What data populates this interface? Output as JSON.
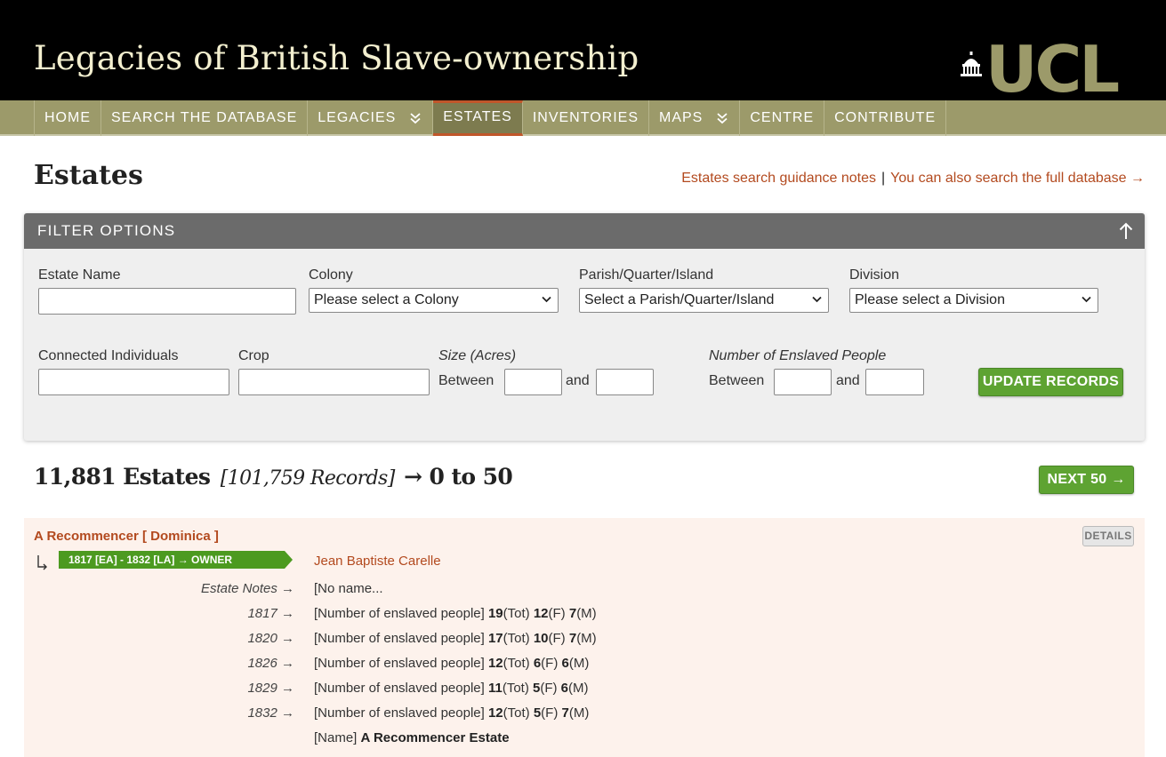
{
  "header": {
    "site_title": "Legacies of British Slave-ownership",
    "logo_text": "UCL"
  },
  "nav": {
    "items": [
      {
        "label": "HOME",
        "dropdown": false,
        "active": false
      },
      {
        "label": "SEARCH THE DATABASE",
        "dropdown": false,
        "active": false
      },
      {
        "label": "LEGACIES",
        "dropdown": true,
        "active": false
      },
      {
        "label": "ESTATES",
        "dropdown": false,
        "active": true
      },
      {
        "label": "INVENTORIES",
        "dropdown": false,
        "active": false
      },
      {
        "label": "MAPS",
        "dropdown": true,
        "active": false
      },
      {
        "label": "CENTRE",
        "dropdown": false,
        "active": false
      },
      {
        "label": "CONTRIBUTE",
        "dropdown": false,
        "active": false
      }
    ]
  },
  "page": {
    "title": "Estates",
    "guidance_link": "Estates search guidance notes",
    "separator": "|",
    "full_db_link": "You can also search the full database →"
  },
  "filter": {
    "heading": "FILTER OPTIONS",
    "estate_name_label": "Estate Name",
    "estate_name_value": "",
    "colony_label": "Colony",
    "colony_selected": "Please select a Colony",
    "parish_label": "Parish/Quarter/Island",
    "parish_selected": "Select a Parish/Quarter/Island",
    "division_label": "Division",
    "division_selected": "Please select a Division",
    "individuals_label": "Connected Individuals",
    "crop_label": "Crop",
    "size_label": "Size (Acres)",
    "enslaved_label": "Number of Enslaved People",
    "between_label": "Between",
    "and_label": "and",
    "update_button": "UPDATE RECORDS"
  },
  "results": {
    "count": "11,881 Estates",
    "records": "[101,759 Records]",
    "range": "→ 0 to 50",
    "next_button": "NEXT 50 →"
  },
  "record": {
    "title": "A Recommencer [ Dominica ]",
    "details_button": "DETAILS",
    "owner_tag": "1817 [EA] - 1832 [LA] → OWNER",
    "owner_name": "Jean Baptiste Carelle",
    "notes_label": "Estate Notes →",
    "notes_value": "[No name...",
    "enslaved_prefix": "[Number of enslaved people]",
    "years": [
      {
        "label": "1817 →",
        "tot": "19",
        "f": "12",
        "m": "7"
      },
      {
        "label": "1820 →",
        "tot": "17",
        "f": "10",
        "m": "7"
      },
      {
        "label": "1826 →",
        "tot": "12",
        "f": "6",
        "m": "6"
      },
      {
        "label": "1829 →",
        "tot": "11",
        "f": "5",
        "m": "6"
      },
      {
        "label": "1832 →",
        "tot": "12",
        "f": "5",
        "m": "7"
      }
    ],
    "tot_suffix": "(Tot)",
    "f_suffix": "(F)",
    "m_suffix": "(M)",
    "name_prefix": "[Name]",
    "name_value": "A Recommencer Estate"
  },
  "colors": {
    "header_bg": "#000000",
    "nav_bg": "#9c9a6a",
    "accent": "#b34a1f",
    "button_green": "#5ea332",
    "record_bg": "#fdf2ec"
  }
}
